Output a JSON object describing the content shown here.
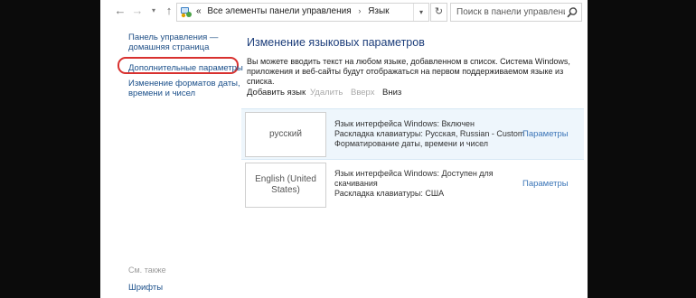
{
  "address": {
    "back_glyph": "←",
    "forward_glyph": "→",
    "dropdown_glyph": "▾",
    "up_glyph": "↑",
    "prefix": "«",
    "breadcrumbs": [
      "Все элементы панели управления",
      "Язык"
    ],
    "separator": "›",
    "refresh_glyph": "↻",
    "search_placeholder": "Поиск в панели управления"
  },
  "sidebar": {
    "home_line1": "Панель управления —",
    "home_line2": "домашняя страница",
    "advanced": "Дополнительные параметры",
    "formats_line1": "Изменение форматов даты,",
    "formats_line2": "времени и чисел",
    "see_also": "См. также",
    "fonts": "Шрифты"
  },
  "main": {
    "title": "Изменение языковых параметров",
    "desc_line1": "Вы можете вводить текст на любом языке, добавленном в список. Система Windows,",
    "desc_line2": "приложения и веб-сайты будут отображаться на первом поддерживаемом языке из списка.",
    "toolbar": {
      "add": "Добавить язык",
      "remove": "Удалить",
      "up": "Вверх",
      "down": "Вниз"
    },
    "languages": [
      {
        "name": "русский",
        "name2": "",
        "info1": "Язык интерфейса Windows: Включен",
        "info2": "Раскладка клавиатуры: Русская, Russian - Custom",
        "info3": "Форматирование даты, времени и чисел",
        "options": "Параметры"
      },
      {
        "name": "English (United",
        "name2": "States)",
        "info1": "Язык интерфейса Windows: Доступен для",
        "info2": "скачивания",
        "info3": "Раскладка клавиатуры: США",
        "options": "Параметры"
      }
    ]
  },
  "colors": {
    "accent_link": "#1a4f8a",
    "title": "#1c3d7a",
    "highlight_ring": "#d8312f",
    "selected_row": "#eef6fc"
  }
}
